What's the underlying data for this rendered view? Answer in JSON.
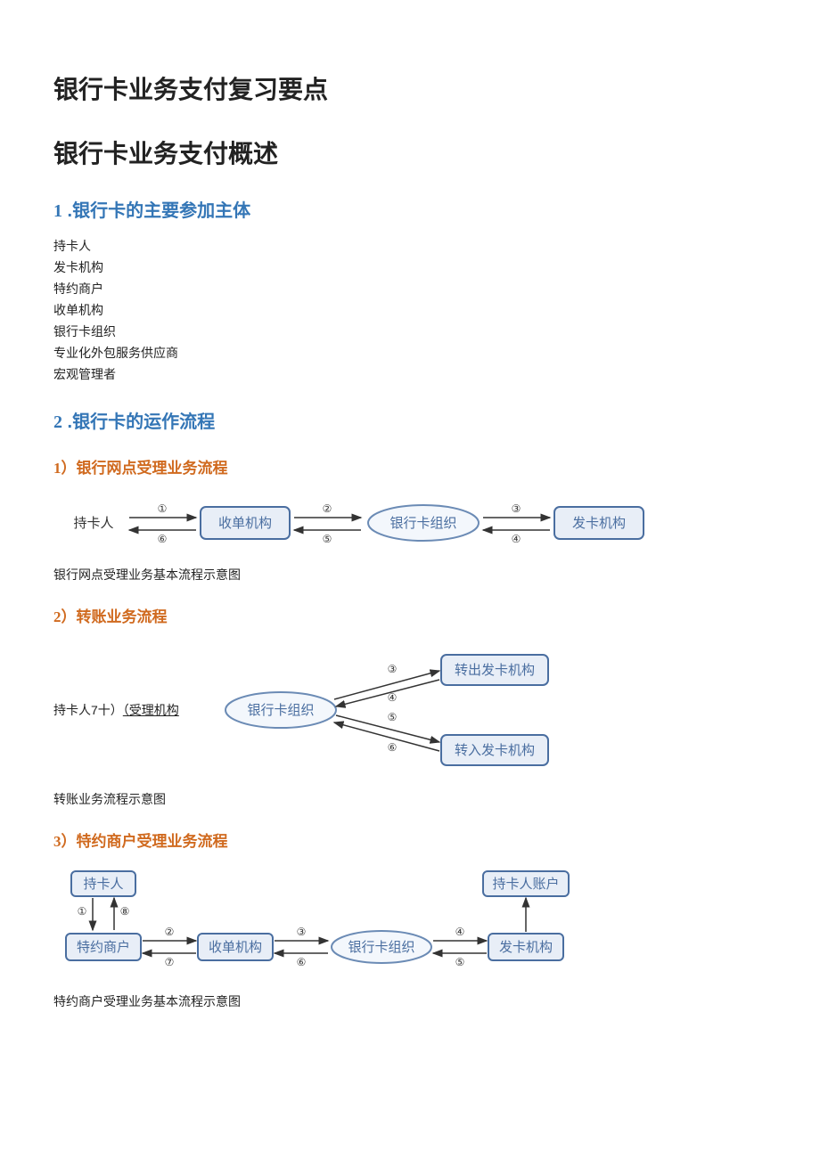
{
  "title1": "银行卡业务支付复习要点",
  "title2": "银行卡业务支付概述",
  "sec1": {
    "num": "1",
    "label": " .银行卡的主要参加主体",
    "items": [
      "持卡人",
      "发卡机构",
      "特约商户",
      "收单机构",
      "银行卡组织",
      "专业化外包服务供应商",
      "宏观管理者"
    ]
  },
  "sec2": {
    "num": "2",
    "label": " .银行卡的运作流程"
  },
  "sub1": {
    "num": "1）",
    "label": "银行网点受理业务流程"
  },
  "d1": {
    "n1": "持卡人",
    "n2": "收单机构",
    "n3": "银行卡组织",
    "n4": "发卡机构",
    "s": [
      "①",
      "②",
      "③",
      "④",
      "⑤",
      "⑥"
    ]
  },
  "cap1": "银行网点受理业务基本流程示意图",
  "sub2": {
    "num": "2）",
    "label": "转账业务流程"
  },
  "d2": {
    "prefix": "持卡人7十）",
    "link": "（受理机构",
    "n1": "银行卡组织",
    "n2": "转出发卡机构",
    "n3": "转入发卡机构",
    "s": [
      "③",
      "④",
      "⑤",
      "⑥"
    ]
  },
  "cap2": "转账业务流程示意图",
  "sub3": {
    "num": "3）",
    "label": "特约商户受理业务流程"
  },
  "d3": {
    "n0": "持卡人",
    "n1": "特约商户",
    "n2": "收单机构",
    "n3": "银行卡组织",
    "n4": "发卡机构",
    "n5": "持卡人账户",
    "s": [
      "①",
      "②",
      "③",
      "④",
      "⑤",
      "⑥",
      "⑦",
      "⑧"
    ]
  },
  "cap3": "特约商户受理业务基本流程示意图"
}
